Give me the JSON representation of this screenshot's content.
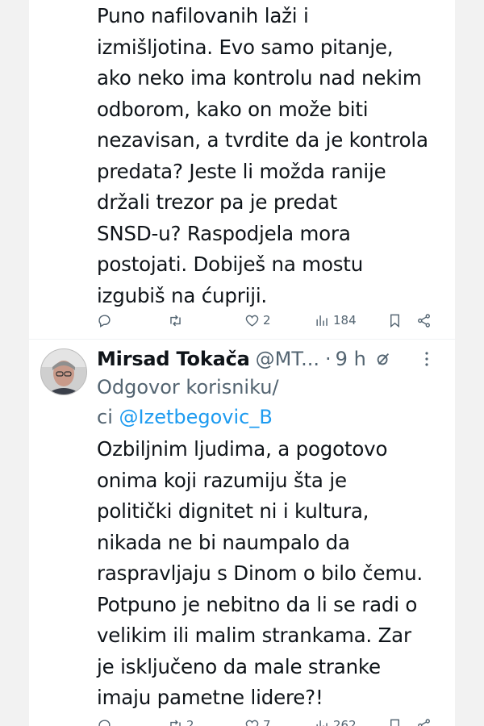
{
  "tweet1": {
    "text": "Puno nafilovanih laži i\nizmišljotina. Evo samo pitanje,\nako neko ima kontrolu nad nekim\nodborom, kako on može biti\nnezavisan, a tvrdite da je kontrola\npredata? Jeste li možda ranije\ndržali trezor pa je predat\nSNSD-u? Raspodjela mora\npostojati. Dobiješ na mostu\nizgubiš na ćupriji.",
    "likes": "2",
    "views": "184"
  },
  "tweet2": {
    "author": "Mirsad Tokača",
    "handle": "@MT...",
    "dot": "·",
    "time": "9 h",
    "replying_prefix": "Odgovor korisniku/",
    "replying_prefix2": "ci",
    "replying_mention": "@Izetbegovic_B",
    "text": "Ozbiljnim ljudima, a pogotovo\nonima koji razumiju šta je\npolitički dignitet ni i kultura,\nnikada ne bi naumpalo da\nraspravljaju s Dinom o bilo čemu.\nPotpuno je nebitno da li se radi o\nvelikim ili malim strankama. Zar\nje isključeno da male stranke\nimaju pametne lidere?!",
    "retweets": "2",
    "likes": "7",
    "views": "262"
  },
  "icons": [
    "reply-icon",
    "retweet-icon",
    "like-icon",
    "views-icon",
    "bookmark-icon",
    "share-icon",
    "grok-icon",
    "more-icon"
  ],
  "colors": {
    "text": "#0f1419",
    "secondary": "#536471",
    "link": "#1d9bf0",
    "background": "#f2f2f2"
  }
}
